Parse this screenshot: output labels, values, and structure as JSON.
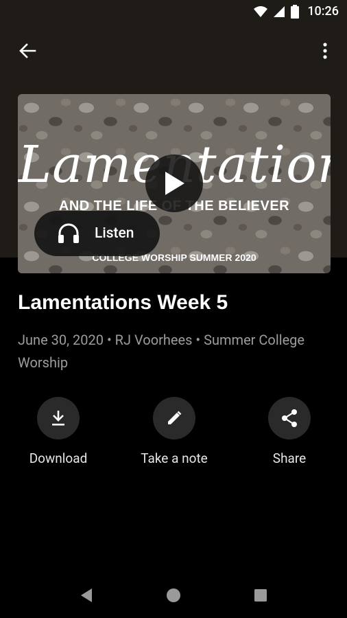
{
  "status": {
    "time": "10:26"
  },
  "hero": {
    "title_art": "Lamentations",
    "subtitle_art": "AND THE LIFE OF THE BELIEVER",
    "footer_art": "COLLEGE WORSHIP SUMMER 2020",
    "listen_label": "Listen"
  },
  "sermon": {
    "title": "Lamentations Week 5",
    "meta": "June 30, 2020 • RJ Voorhees • Summer College Worship"
  },
  "actions": {
    "download": "Download",
    "note": "Take a note",
    "share": "Share"
  },
  "colors": {
    "header_bg": "#1f1b17",
    "page_bg": "#000000",
    "circle_bg": "#2a2a2a",
    "meta_text": "#9c9c9c"
  },
  "icons": [
    "wifi-icon",
    "signal-icon",
    "battery-icon",
    "back-arrow-icon",
    "more-vert-icon",
    "play-icon",
    "headphones-icon",
    "download-icon",
    "pencil-icon",
    "share-icon",
    "nav-back-icon",
    "nav-home-icon",
    "nav-recents-icon"
  ]
}
